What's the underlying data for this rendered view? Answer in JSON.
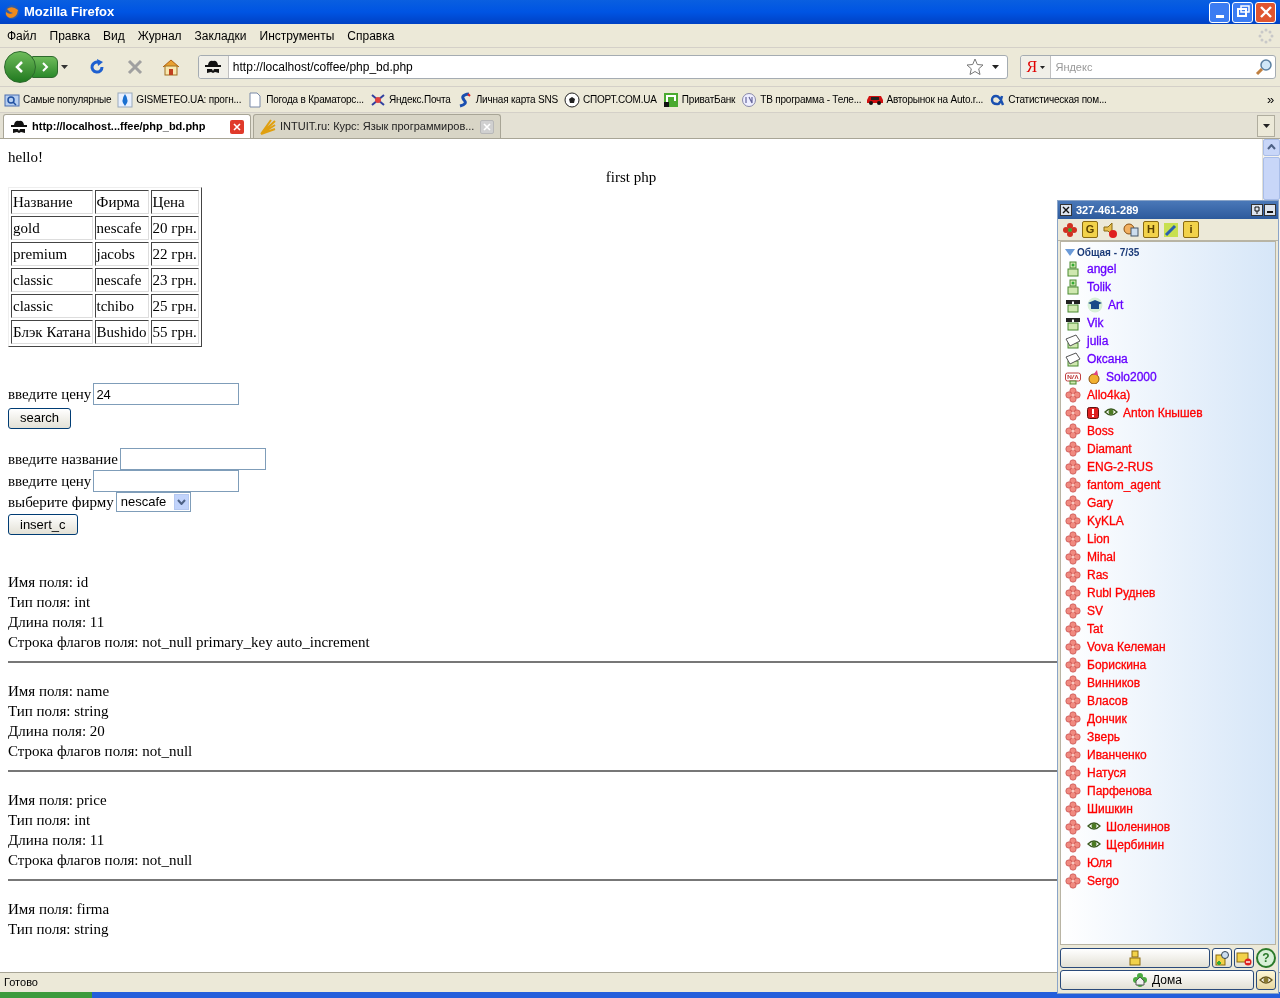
{
  "window": {
    "title": "Mozilla Firefox"
  },
  "menu": [
    "Файл",
    "Правка",
    "Вид",
    "Журнал",
    "Закладки",
    "Инструменты",
    "Справка"
  ],
  "address": {
    "url": "http://localhost/coffee/php_bd.php"
  },
  "search": {
    "engine": "Я",
    "placeholder": "Яндекс"
  },
  "bookmarks": [
    {
      "label": "Самые популярные",
      "kind": "folder"
    },
    {
      "label": "GISMETEO.UA: прогн...",
      "kind": "drop"
    },
    {
      "label": "Погода в Краматорс...",
      "kind": "page"
    },
    {
      "label": "Яндекс.Почта",
      "kind": "mail"
    },
    {
      "label": "Личная карта SNS",
      "kind": "sns"
    },
    {
      "label": "СПОРТ.COM.UA",
      "kind": "ball"
    },
    {
      "label": "ПриватБанк",
      "kind": "bank"
    },
    {
      "label": "ТВ программа - Теле...",
      "kind": "tv"
    },
    {
      "label": "Авторынок на Auto.r...",
      "kind": "car"
    },
    {
      "label": "Статистическая пом...",
      "kind": "alpha"
    }
  ],
  "bookmarks_more": "»",
  "tabs": [
    {
      "label": "http://localhost...ffee/php_bd.php",
      "selected": true
    },
    {
      "label": "INTUIT.ru: Курс: Язык программиров...",
      "selected": false
    }
  ],
  "page": {
    "greeting": "hello!",
    "heading": "first php",
    "table": {
      "columns": [
        "Название",
        "Фирма",
        "Цена"
      ],
      "rows": [
        [
          "gold",
          "nescafe",
          "20 грн."
        ],
        [
          "premium",
          "jacobs",
          "22 грн."
        ],
        [
          "classic",
          "nescafe",
          "23 грн."
        ],
        [
          "classic",
          "tchibo",
          "25 грн."
        ],
        [
          "Блэк Катана",
          "Bushido",
          "55 грн."
        ]
      ]
    },
    "search_form": {
      "label": "введите цену",
      "value": "24",
      "button": "search"
    },
    "insert_form": {
      "name_label": "введите название",
      "price_label": "введите цену",
      "firm_label": "выберите фирму",
      "firm_value": "nescafe",
      "button": "insert_c"
    },
    "fields": [
      {
        "lines": [
          "Имя поля: id",
          "Тип поля: int",
          "Длина поля: 11",
          "Строка флагов поля: not_null primary_key auto_increment"
        ]
      },
      {
        "lines": [
          "Имя поля: name",
          "Тип поля: string",
          "Длина поля: 20",
          "Строка флагов поля: not_null"
        ]
      },
      {
        "lines": [
          "Имя поля: price",
          "Тип поля: int",
          "Длина поля: 11",
          "Строка флагов поля: not_null"
        ]
      },
      {
        "lines": [
          "Имя поля: firma",
          "Тип поля: string"
        ]
      }
    ]
  },
  "status_bar": "Готово",
  "icq": {
    "uin": "327-461-289",
    "toolbar": [
      {
        "kind": "flower"
      },
      {
        "kind": "letter",
        "label": "G"
      },
      {
        "kind": "mute"
      },
      {
        "kind": "card"
      },
      {
        "kind": "letter",
        "label": "H"
      },
      {
        "kind": "wrench"
      },
      {
        "kind": "letter",
        "label": "i"
      }
    ],
    "group": {
      "label": "Общая - 7/35",
      "expanded": true
    },
    "contacts": [
      {
        "name": "angel",
        "kind": "online",
        "color": "#6600ff"
      },
      {
        "name": "Tolik",
        "kind": "online",
        "color": "#6600ff"
      },
      {
        "name": "Art",
        "kind": "sunglasses",
        "badges": [
          {
            "kind": "cap"
          }
        ],
        "color": "#6600ff"
      },
      {
        "name": "Vik",
        "kind": "sunglasses",
        "color": "#6600ff"
      },
      {
        "name": "julia",
        "kind": "note",
        "color": "#6600ff"
      },
      {
        "name": "Оксана",
        "kind": "note",
        "color": "#6600ff"
      },
      {
        "name": "Solo2000",
        "kind": "na",
        "badges": [
          {
            "kind": "party"
          }
        ],
        "color": "#6600ff"
      },
      {
        "name": "Allo4ka)",
        "kind": "offline",
        "color": "#ff0000"
      },
      {
        "name": "Anton Кнышев",
        "kind": "offline",
        "badges": [
          {
            "kind": "alert"
          },
          {
            "kind": "eye"
          }
        ],
        "color": "#ff0000"
      },
      {
        "name": "Boss",
        "kind": "offline",
        "color": "#ff0000"
      },
      {
        "name": "Diamant",
        "kind": "offline",
        "color": "#ff0000"
      },
      {
        "name": "ENG-2-RUS",
        "kind": "offline",
        "color": "#ff0000"
      },
      {
        "name": "fantom_agent",
        "kind": "offline",
        "color": "#ff0000"
      },
      {
        "name": "Gary",
        "kind": "offline",
        "color": "#ff0000"
      },
      {
        "name": "KyKLA",
        "kind": "offline",
        "color": "#ff0000"
      },
      {
        "name": "Lion",
        "kind": "offline",
        "color": "#ff0000"
      },
      {
        "name": "Mihal",
        "kind": "offline",
        "color": "#ff0000"
      },
      {
        "name": "Ras",
        "kind": "offline",
        "color": "#ff0000"
      },
      {
        "name": "Rubl Руднев",
        "kind": "offline",
        "color": "#ff0000"
      },
      {
        "name": "SV",
        "kind": "offline",
        "color": "#ff0000"
      },
      {
        "name": "Tat",
        "kind": "offline",
        "color": "#ff0000"
      },
      {
        "name": "Vova Келеман",
        "kind": "offline",
        "color": "#ff0000"
      },
      {
        "name": "Борискина",
        "kind": "offline",
        "color": "#ff0000"
      },
      {
        "name": "Винников",
        "kind": "offline",
        "color": "#ff0000"
      },
      {
        "name": "Власов",
        "kind": "offline",
        "color": "#ff0000"
      },
      {
        "name": "Дончик",
        "kind": "offline",
        "color": "#ff0000"
      },
      {
        "name": "Зверь",
        "kind": "offline",
        "color": "#ff0000"
      },
      {
        "name": "Иванченко",
        "kind": "offline",
        "color": "#ff0000"
      },
      {
        "name": "Натуся",
        "kind": "offline",
        "color": "#ff0000"
      },
      {
        "name": "Парфенова",
        "kind": "offline",
        "color": "#ff0000"
      },
      {
        "name": "Шишкин",
        "kind": "offline",
        "color": "#ff0000"
      },
      {
        "name": "Шоленинов",
        "kind": "offline",
        "badges": [
          {
            "kind": "eye"
          }
        ],
        "color": "#ff0000"
      },
      {
        "name": "Щербинин",
        "kind": "offline",
        "badges": [
          {
            "kind": "eye"
          }
        ],
        "color": "#ff0000"
      },
      {
        "name": "Юля",
        "kind": "offline",
        "color": "#ff0000"
      },
      {
        "name": "Sergo",
        "kind": "offline",
        "color": "#ff0000"
      }
    ],
    "help_label": "?",
    "status_button": "Дома"
  }
}
